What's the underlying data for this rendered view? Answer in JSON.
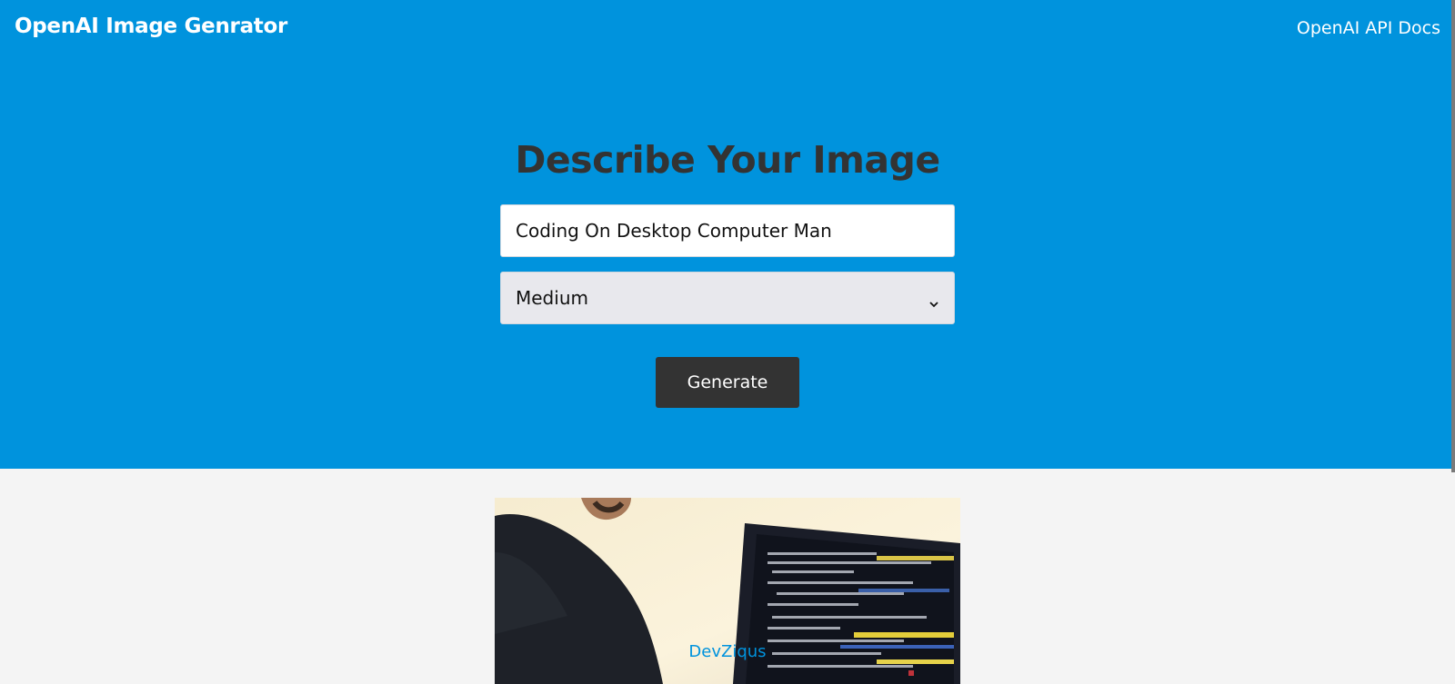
{
  "header": {
    "brand": "OpenAI Image Genrator",
    "api_docs_link": "OpenAI API Docs"
  },
  "form": {
    "heading": "Describe Your Image",
    "prompt_value": "Coding On Desktop Computer Man",
    "size_selected": "Medium",
    "generate_label": "Generate"
  },
  "result": {
    "watermark": "DevZiqus"
  },
  "colors": {
    "hero_bg": "#0093dd",
    "page_bg": "#f4f4f4",
    "button_bg": "#333333",
    "heading_text": "#333333"
  },
  "icons": {
    "select_arrow": "chevron-down-icon"
  }
}
